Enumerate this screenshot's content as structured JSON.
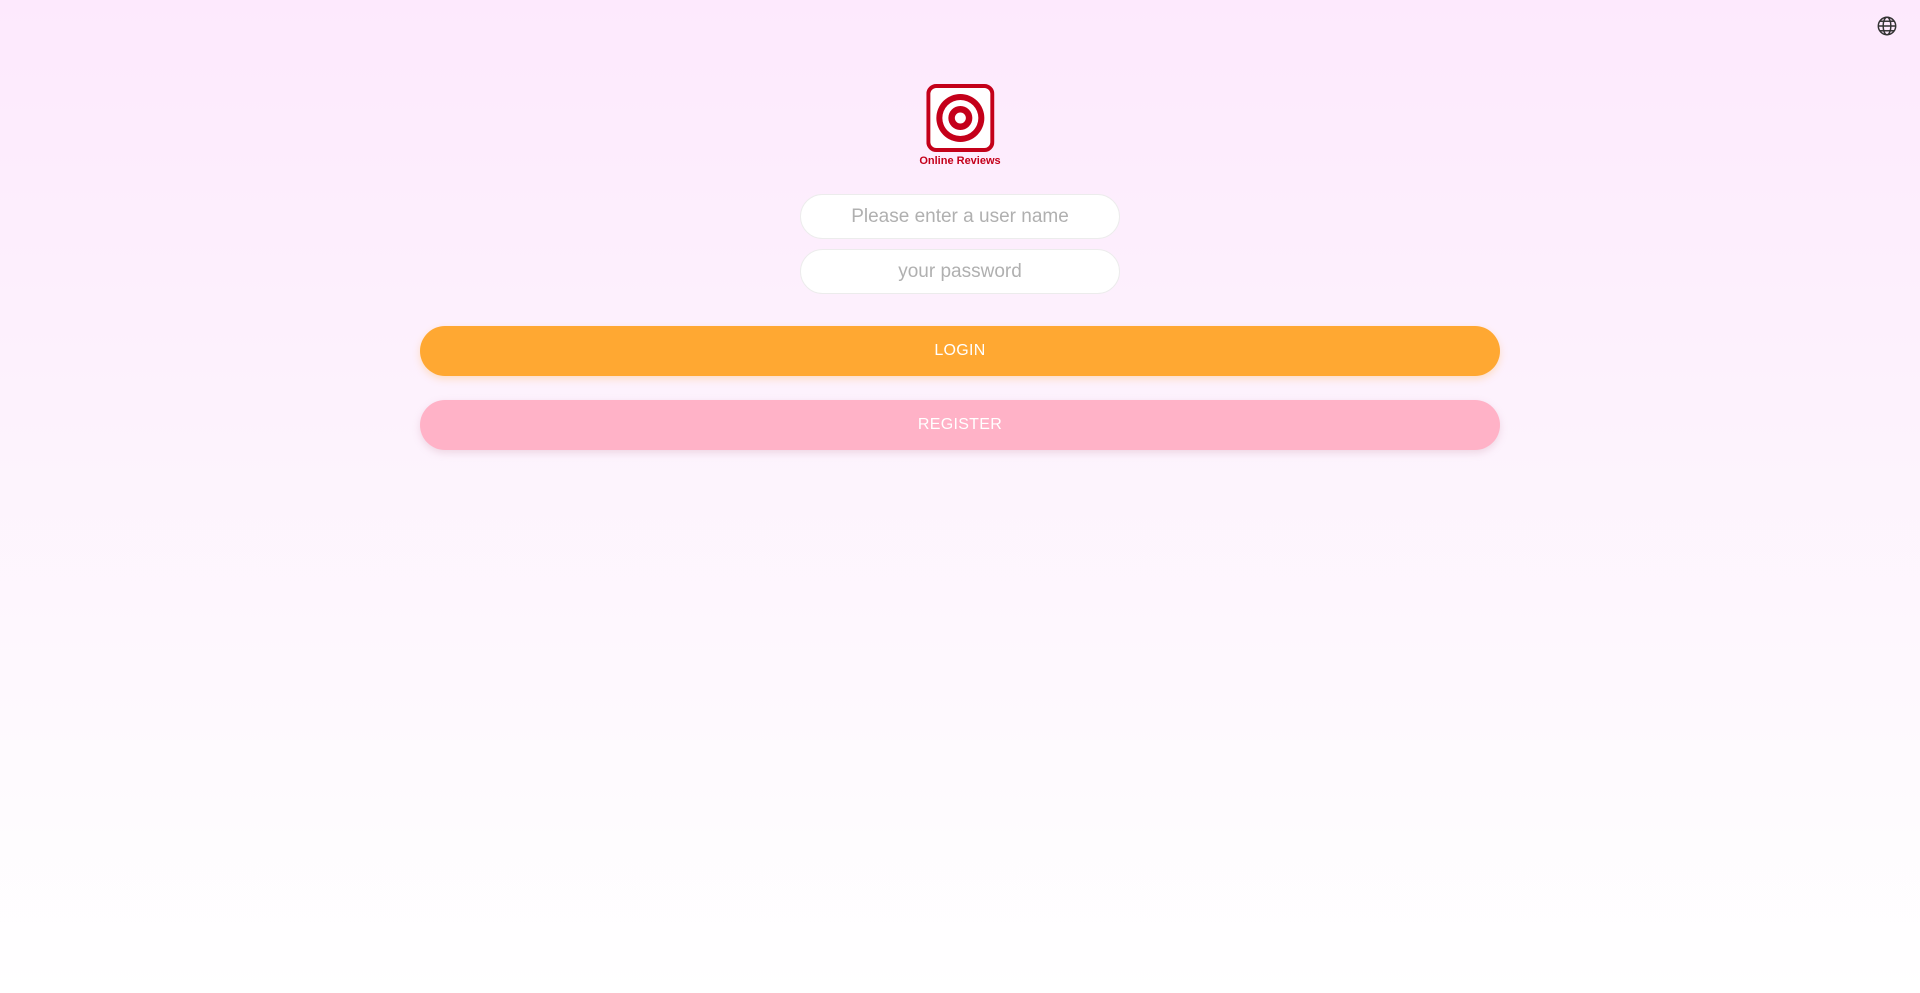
{
  "header": {
    "language_icon": "globe-icon"
  },
  "logo": {
    "icon": "target-icon",
    "text": "Online Reviews",
    "color": "#c4001a"
  },
  "form": {
    "username_placeholder": "Please enter a user name",
    "password_placeholder": "your password",
    "login_label": "LOGIN",
    "register_label": "REGISTER"
  },
  "colors": {
    "login_button": "#ffa832",
    "register_button": "#ffb2c7",
    "background_top": "#fde9fd"
  }
}
